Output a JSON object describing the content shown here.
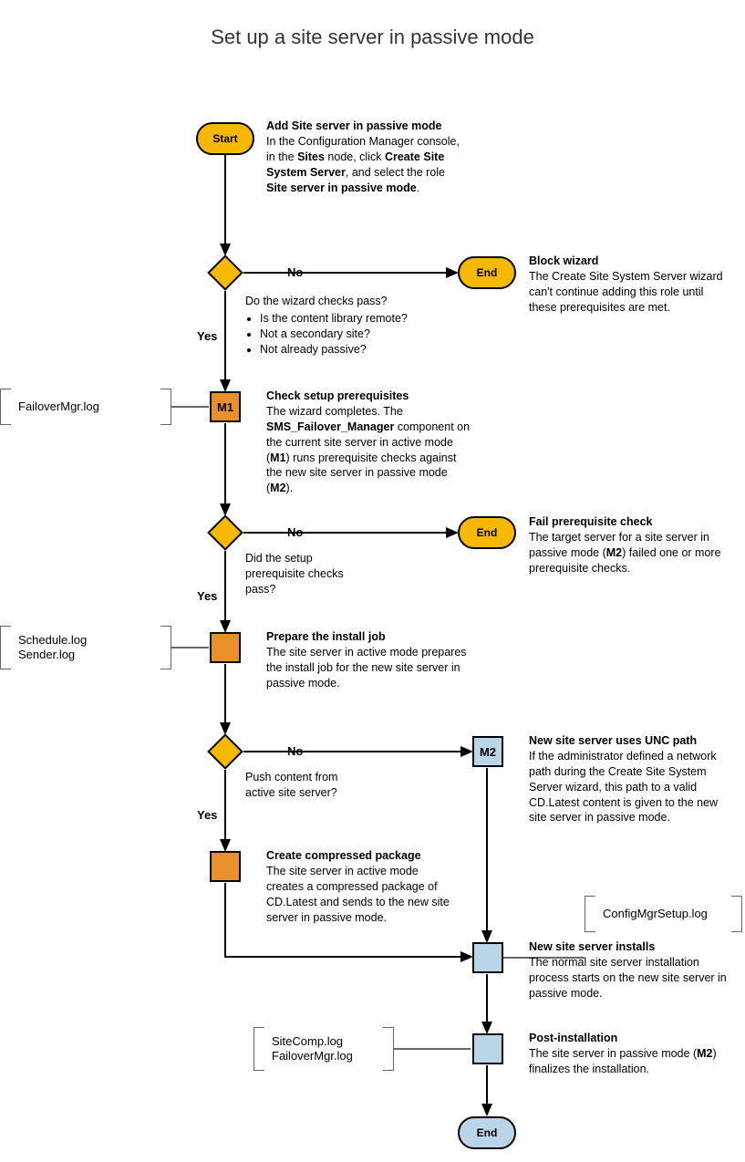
{
  "title": "Set up a site server in passive mode",
  "nodes": {
    "start": "Start",
    "end1": "End",
    "end2": "End",
    "end3": "End",
    "m1": "M1",
    "m2": "M2"
  },
  "labels": {
    "no1": "No",
    "yes1": "Yes",
    "no2": "No",
    "yes2": "Yes",
    "no3": "No",
    "yes3": "Yes"
  },
  "text": {
    "addSite": {
      "title": "Add Site server in passive mode",
      "body1": "In the Configuration Manager console, in the ",
      "b1": "Sites",
      "body2": " node, click ",
      "b2": "Create Site System Server",
      "body3": ", and select the role ",
      "b3": "Site server in passive mode",
      "body4": "."
    },
    "wizardQ": {
      "q": "Do the wizard checks pass?",
      "li1": "Is the content library remote?",
      "li2": "Not a secondary site?",
      "li3": "Not already passive?"
    },
    "blockWizard": {
      "title": "Block wizard",
      "body": "The Create Site System Server wizard can't continue adding this role until these prerequisites are met."
    },
    "checkPrereq": {
      "title": "Check setup prerequisites",
      "body1": "The wizard completes. The ",
      "b1": "SMS_Failover_Manager",
      "body2": " component on the current site server in active mode (",
      "b2": "M1",
      "body3": ") runs prerequisite checks against the new site server in passive mode (",
      "b3": "M2",
      "body4": ")."
    },
    "prereqQ": {
      "q": "Did the setup prerequisite checks pass?"
    },
    "failPrereq": {
      "title": "Fail prerequisite check",
      "body1": "The target server for a site server in passive mode (",
      "b1": "M2",
      "body2": ") failed one or more prerequisite checks."
    },
    "prepare": {
      "title": "Prepare the install job",
      "body": "The site server in active mode prepares the install job for the new site server in passive mode."
    },
    "pushQ": {
      "q": "Push content from active site server?"
    },
    "unc": {
      "title": "New site server uses UNC path",
      "body": "If the administrator defined a network path during the Create Site System Server wizard, this path to a valid CD.Latest content is given to the new site server in passive mode."
    },
    "compressed": {
      "title": "Create compressed package",
      "body": "The site server in active mode creates a compressed package of CD.Latest and sends to the new site server in passive mode."
    },
    "installs": {
      "title": "New site server installs",
      "body": "The normal site server installation process starts on the new site server in passive mode."
    },
    "post": {
      "title": "Post-installation",
      "body1": "The site server in passive mode (",
      "b1": "M2",
      "body2": ") finalizes the installation."
    }
  },
  "logs": {
    "failover": "FailoverMgr.log",
    "schedule": "Schedule.log",
    "sender": "Sender.log",
    "config": "ConfigMgrSetup.log",
    "sitecomp": "SiteComp.log",
    "failover2": "FailoverMgr.log"
  },
  "chart_data": {
    "type": "flowchart",
    "title": "Set up a site server in passive mode",
    "nodes": [
      {
        "id": "start",
        "kind": "terminator",
        "label": "Start"
      },
      {
        "id": "addSite",
        "kind": "text",
        "label": "Add Site server in passive mode"
      },
      {
        "id": "d1",
        "kind": "decision",
        "label": "Do the wizard checks pass? (content library remote / not secondary / not already passive)"
      },
      {
        "id": "end1",
        "kind": "terminator",
        "label": "End",
        "note": "Block wizard"
      },
      {
        "id": "m1",
        "kind": "process",
        "label": "M1 – Check setup prerequisites (SMS_Failover_Manager on active mode)",
        "log": "FailoverMgr.log"
      },
      {
        "id": "d2",
        "kind": "decision",
        "label": "Did the setup prerequisite checks pass?"
      },
      {
        "id": "end2",
        "kind": "terminator",
        "label": "End",
        "note": "Fail prerequisite check"
      },
      {
        "id": "prepare",
        "kind": "process",
        "label": "Prepare the install job",
        "log": "Schedule.log, Sender.log"
      },
      {
        "id": "d3",
        "kind": "decision",
        "label": "Push content from active site server?"
      },
      {
        "id": "m2",
        "kind": "process",
        "label": "M2 – New site server uses UNC path"
      },
      {
        "id": "compressed",
        "kind": "process",
        "label": "Create compressed package"
      },
      {
        "id": "installs",
        "kind": "process",
        "label": "New site server installs",
        "log": "ConfigMgrSetup.log"
      },
      {
        "id": "post",
        "kind": "process",
        "label": "Post-installation",
        "log": "SiteComp.log, FailoverMgr.log"
      },
      {
        "id": "end3",
        "kind": "terminator",
        "label": "End"
      }
    ],
    "edges": [
      {
        "from": "start",
        "to": "d1"
      },
      {
        "from": "d1",
        "to": "end1",
        "label": "No"
      },
      {
        "from": "d1",
        "to": "m1",
        "label": "Yes"
      },
      {
        "from": "m1",
        "to": "d2"
      },
      {
        "from": "d2",
        "to": "end2",
        "label": "No"
      },
      {
        "from": "d2",
        "to": "prepare",
        "label": "Yes"
      },
      {
        "from": "prepare",
        "to": "d3"
      },
      {
        "from": "d3",
        "to": "m2",
        "label": "No"
      },
      {
        "from": "d3",
        "to": "compressed",
        "label": "Yes"
      },
      {
        "from": "m2",
        "to": "installs"
      },
      {
        "from": "compressed",
        "to": "installs"
      },
      {
        "from": "installs",
        "to": "post"
      },
      {
        "from": "post",
        "to": "end3"
      }
    ]
  }
}
